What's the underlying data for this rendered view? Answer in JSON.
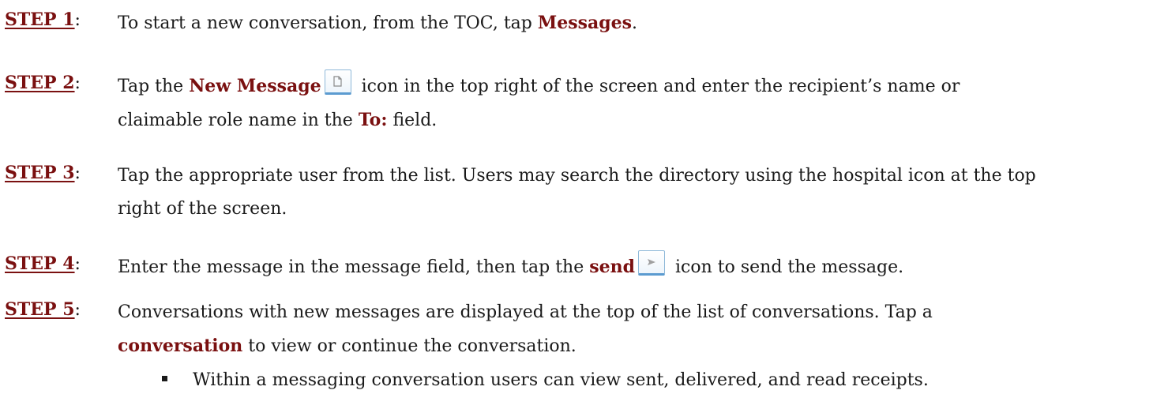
{
  "steps": [
    {
      "label": "STEP 1",
      "parts": [
        "To start a new conversation, from the TOC, tap ",
        "Messages",
        "."
      ]
    },
    {
      "label": "STEP 2",
      "parts": [
        "Tap the ",
        "New Message",
        " icon in the top right of the screen and enter the recipient’s name or claimable role name in the ",
        "To:",
        " field."
      ],
      "icon": "new-message-icon"
    },
    {
      "label": "STEP 3",
      "text": "Tap the appropriate user from the list. Users may search the directory using the hospital icon at the top right of the screen."
    },
    {
      "label": "STEP 4",
      "parts": [
        "Enter the message in the message field, then tap the ",
        "send",
        " icon to send the message."
      ],
      "icon": "send-icon"
    },
    {
      "label": "STEP 5",
      "parts": [
        "Conversations with new messages are displayed at the top of the list of conversations. Tap a ",
        "conversation",
        " to view or continue the conversation."
      ]
    }
  ],
  "bullets": [
    "Within a messaging conversation users can view sent, delivered, and read receipts."
  ],
  "colors": {
    "label": "#7a1010",
    "text": "#1a1a1a",
    "icon_border": "#5b9bd0"
  }
}
